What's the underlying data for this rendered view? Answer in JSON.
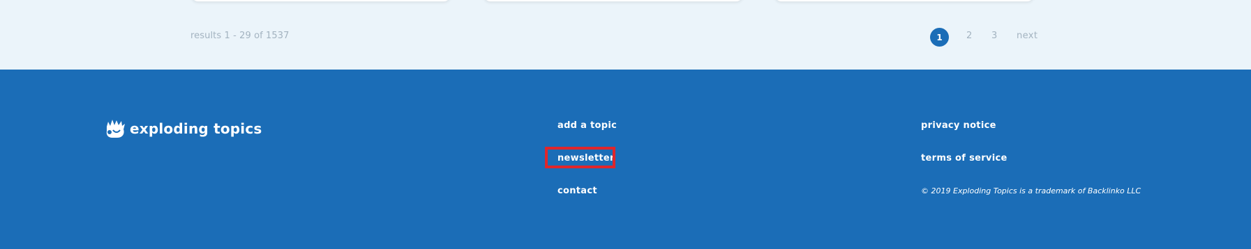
{
  "results": {
    "text": "results 1 - 29 of 1537"
  },
  "pagination": {
    "current": "1",
    "pages": [
      "2",
      "3"
    ],
    "next_label": "next",
    "accent_color": "#1b6db7"
  },
  "footer": {
    "background_color": "#1b6db7",
    "logo": {
      "text": "exploding topics",
      "icon": "exploding-splash-icon"
    },
    "links_col1": [
      "add a topic",
      "newsletter",
      "contact"
    ],
    "links_col2": [
      "privacy notice",
      "terms of service"
    ],
    "copyright": "© 2019  Exploding Topics is a trademark of Backlinko LLC"
  },
  "highlight": {
    "target": "newsletter",
    "color": "#e0262b"
  }
}
